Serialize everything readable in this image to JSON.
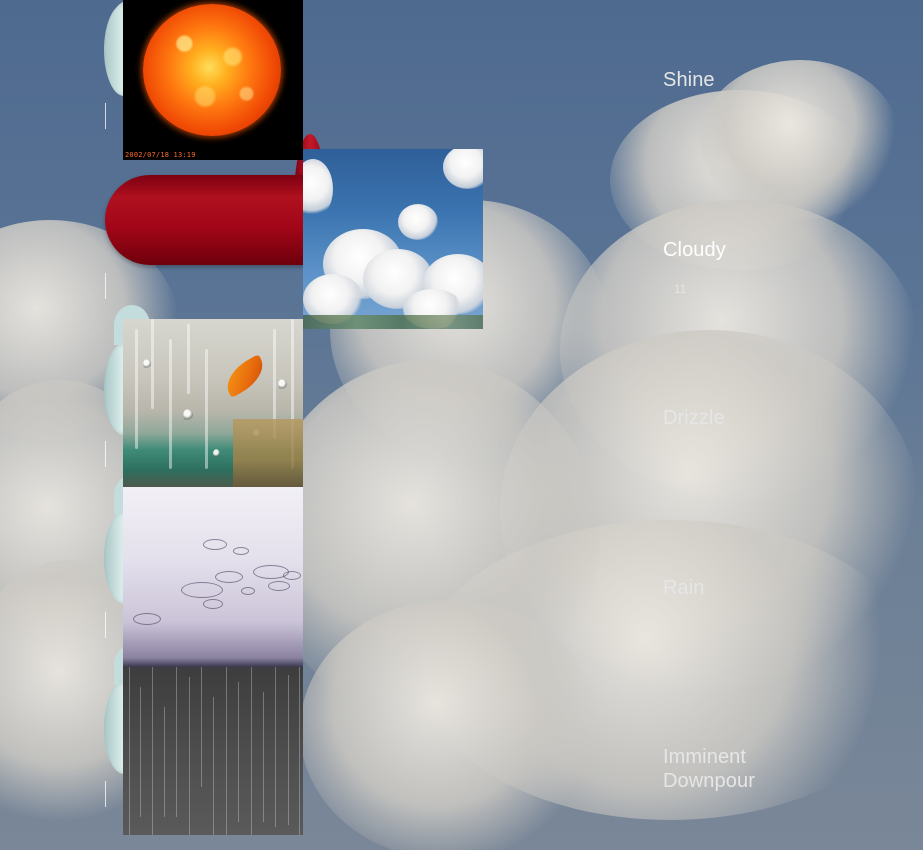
{
  "categories": [
    {
      "id": "shine",
      "label": "Shine",
      "active": false
    },
    {
      "id": "cloudy",
      "label": "Cloudy",
      "active": true,
      "count": "11"
    },
    {
      "id": "drizzle",
      "label": "Drizzle",
      "active": false
    },
    {
      "id": "rain",
      "label": "Rain",
      "active": false
    },
    {
      "id": "downpour",
      "label": "Imminent Downpour",
      "active": false
    }
  ],
  "thumbnails": {
    "sun_timestamp": "2002/07/18 13:19"
  },
  "colors": {
    "active_tab": "#a00617",
    "inactive_tab": "#c3dddc",
    "label_text": "#e6e6e6",
    "sky": "#56708f"
  },
  "icons": {
    "sun": "sun-photo",
    "cloudy": "cloudy-sky-photo",
    "drizzle": "drizzle-window-photo",
    "rain": "rain-ripples-photo",
    "downpour": "downpour-photo"
  }
}
